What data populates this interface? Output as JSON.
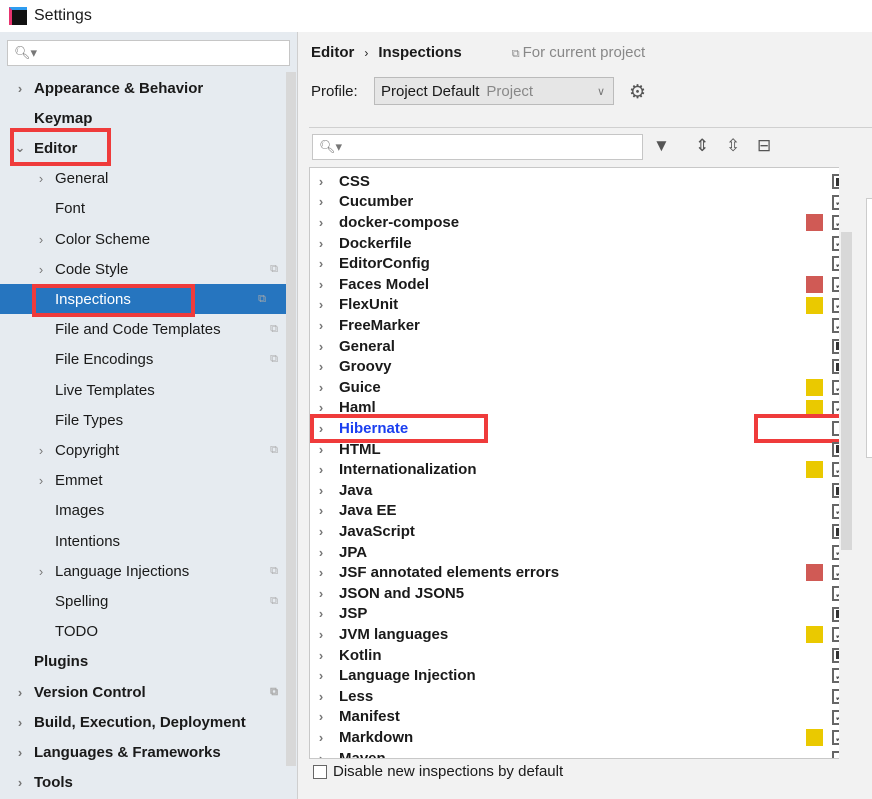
{
  "window": {
    "title": "Settings",
    "icon": "intellij-logo-icon",
    "icon_text": "IJ"
  },
  "sidebar": {
    "search_placeholder": "",
    "items": [
      {
        "label": "Appearance & Behavior",
        "bold": true,
        "chevron": "right",
        "indent": 0
      },
      {
        "label": "Keymap",
        "bold": true,
        "indent": 0
      },
      {
        "label": "Editor",
        "bold": true,
        "chevron": "down",
        "indent": 0,
        "highlighted": true
      },
      {
        "label": "General",
        "chevron": "right",
        "indent": 1
      },
      {
        "label": "Font",
        "indent": 1
      },
      {
        "label": "Color Scheme",
        "chevron": "right",
        "indent": 1
      },
      {
        "label": "Code Style",
        "chevron": "right",
        "indent": 1,
        "project_icon": true
      },
      {
        "label": "Inspections",
        "indent": 1,
        "selected": true,
        "project_icon": true,
        "highlighted": true
      },
      {
        "label": "File and Code Templates",
        "indent": 1,
        "project_icon": true
      },
      {
        "label": "File Encodings",
        "indent": 1,
        "project_icon": true
      },
      {
        "label": "Live Templates",
        "indent": 1
      },
      {
        "label": "File Types",
        "indent": 1
      },
      {
        "label": "Copyright",
        "chevron": "right",
        "indent": 1,
        "project_icon": true
      },
      {
        "label": "Emmet",
        "chevron": "right",
        "indent": 1
      },
      {
        "label": "Images",
        "indent": 1
      },
      {
        "label": "Intentions",
        "indent": 1
      },
      {
        "label": "Language Injections",
        "chevron": "right",
        "indent": 1,
        "project_icon": true
      },
      {
        "label": "Spelling",
        "indent": 1,
        "project_icon": true
      },
      {
        "label": "TODO",
        "indent": 1
      },
      {
        "label": "Plugins",
        "bold": true,
        "indent": 0
      },
      {
        "label": "Version Control",
        "bold": true,
        "chevron": "right",
        "indent": 0,
        "project_icon": true
      },
      {
        "label": "Build, Execution, Deployment",
        "bold": true,
        "chevron": "right",
        "indent": 0
      },
      {
        "label": "Languages & Frameworks",
        "bold": true,
        "chevron": "right",
        "indent": 0
      },
      {
        "label": "Tools",
        "bold": true,
        "chevron": "right",
        "indent": 0
      }
    ]
  },
  "main": {
    "breadcrumb": [
      "Editor",
      "Inspections"
    ],
    "scope": "For current project",
    "profile_label": "Profile:",
    "profile_value": "Project Default",
    "profile_sub": "Project",
    "colors": {
      "error": "#d05a55",
      "warning": "#eac900",
      "highlight": "#ef3b3b",
      "selection": "#2675bf"
    },
    "inspections": [
      {
        "name": "CSS",
        "state": "partial"
      },
      {
        "name": "Cucumber",
        "state": "checked"
      },
      {
        "name": "docker-compose",
        "state": "checked",
        "severity": "error"
      },
      {
        "name": "Dockerfile",
        "state": "checked"
      },
      {
        "name": "EditorConfig",
        "state": "checked"
      },
      {
        "name": "Faces Model",
        "state": "checked",
        "severity": "error"
      },
      {
        "name": "FlexUnit",
        "state": "checked",
        "severity": "warning"
      },
      {
        "name": "FreeMarker",
        "state": "checked"
      },
      {
        "name": "General",
        "state": "partial"
      },
      {
        "name": "Groovy",
        "state": "partial"
      },
      {
        "name": "Guice",
        "state": "checked",
        "severity": "warning"
      },
      {
        "name": "Haml",
        "state": "checked",
        "severity": "warning"
      },
      {
        "name": "Hibernate",
        "state": "unchecked",
        "highlighted": true
      },
      {
        "name": "HTML",
        "state": "partial"
      },
      {
        "name": "Internationalization",
        "state": "checked",
        "severity": "warning"
      },
      {
        "name": "Java",
        "state": "partial"
      },
      {
        "name": "Java EE",
        "state": "checked"
      },
      {
        "name": "JavaScript",
        "state": "partial"
      },
      {
        "name": "JPA",
        "state": "checked"
      },
      {
        "name": "JSF annotated elements errors",
        "state": "checked",
        "severity": "error"
      },
      {
        "name": "JSON and JSON5",
        "state": "checked"
      },
      {
        "name": "JSP",
        "state": "partial"
      },
      {
        "name": "JVM languages",
        "state": "checked",
        "severity": "warning"
      },
      {
        "name": "Kotlin",
        "state": "partial"
      },
      {
        "name": "Language Injection",
        "state": "checked"
      },
      {
        "name": "Less",
        "state": "checked"
      },
      {
        "name": "Manifest",
        "state": "checked"
      },
      {
        "name": "Markdown",
        "state": "checked",
        "severity": "warning"
      },
      {
        "name": "Maven",
        "state": "checked"
      }
    ],
    "disable_new_label": "Disable new inspections by default"
  }
}
